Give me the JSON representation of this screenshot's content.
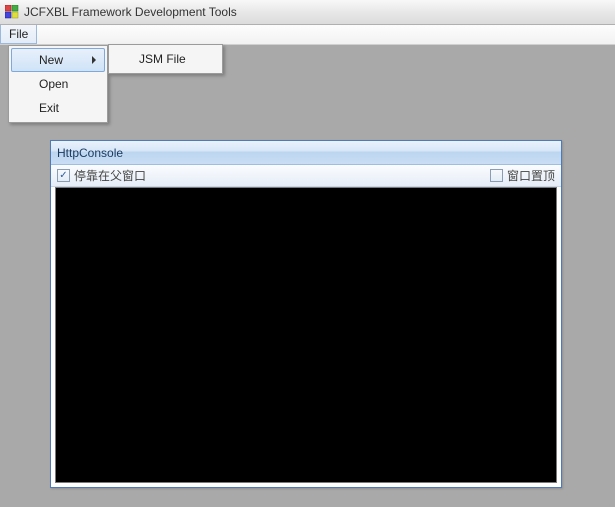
{
  "window": {
    "title": "JCFXBL Framework Development Tools"
  },
  "menubar": {
    "file_label": "File"
  },
  "file_menu": {
    "items": [
      {
        "label": "New",
        "has_submenu": true
      },
      {
        "label": "Open",
        "has_submenu": false
      },
      {
        "label": "Exit",
        "has_submenu": false
      }
    ]
  },
  "new_submenu": {
    "items": [
      {
        "label": "JSM File"
      }
    ]
  },
  "child_window": {
    "title": "HttpConsole",
    "dock_checkbox": {
      "label": "停靠在父窗口",
      "checked": true
    },
    "topmost_checkbox": {
      "label": "窗口置顶",
      "checked": false
    }
  }
}
